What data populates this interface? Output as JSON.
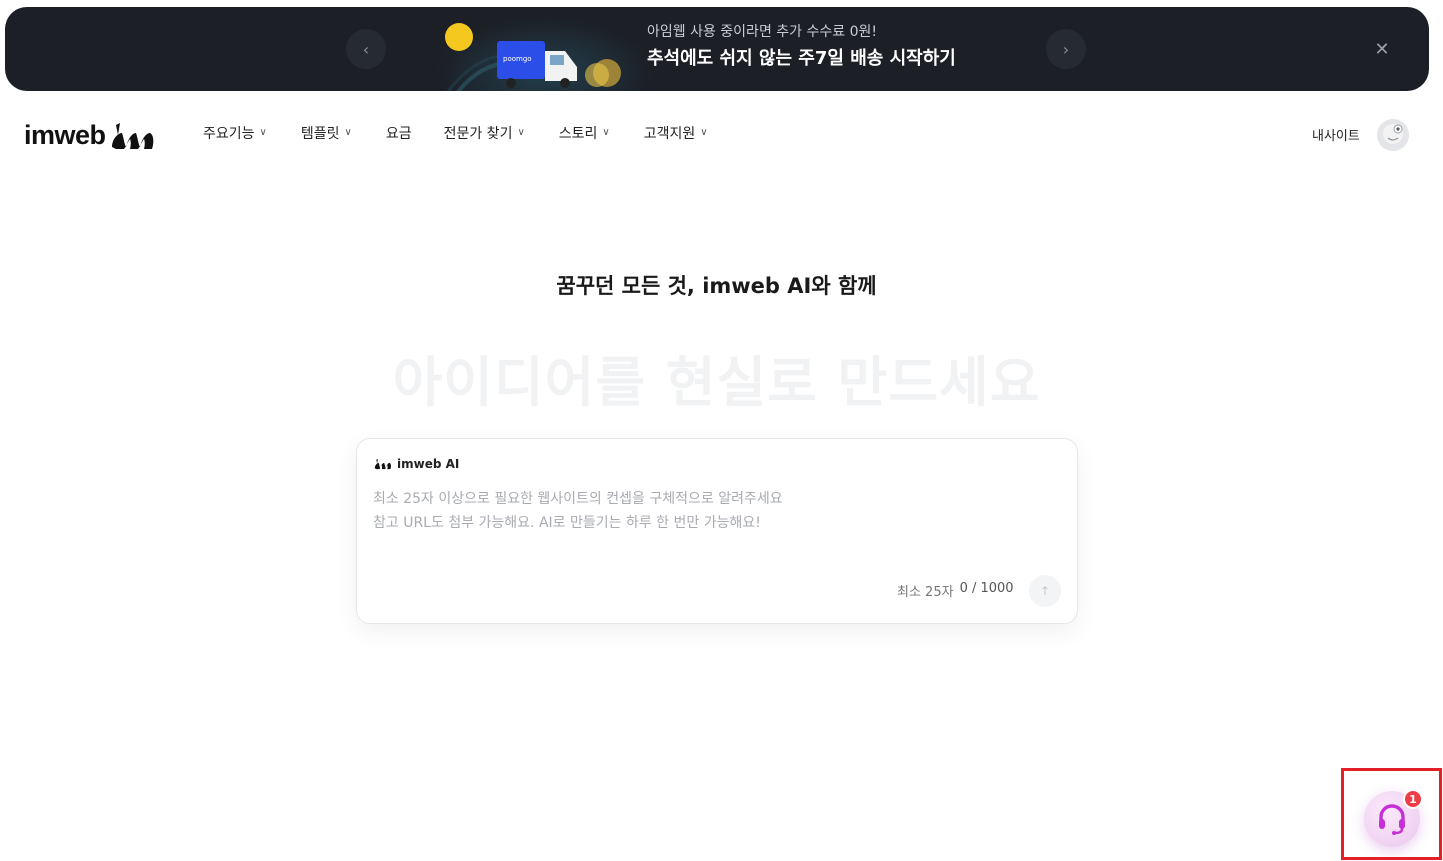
{
  "banner": {
    "subtitle": "아임웹 사용 중이라면 추가 수수료 0원!",
    "title": "추석에도 쉬지 않는 주7일 배송 시작하기",
    "truck_label": "poomgo",
    "prev_icon": "chevron-left-icon",
    "next_icon": "chevron-right-icon",
    "close_icon": "close-icon"
  },
  "header": {
    "logo_text": "imweb",
    "menu": [
      {
        "label": "주요기능",
        "has_dropdown": true
      },
      {
        "label": "템플릿",
        "has_dropdown": true
      },
      {
        "label": "요금",
        "has_dropdown": false
      },
      {
        "label": "전문가 찾기",
        "has_dropdown": true
      },
      {
        "label": "스토리",
        "has_dropdown": true
      },
      {
        "label": "고객지원",
        "has_dropdown": true
      }
    ],
    "my_site_label": "내사이트"
  },
  "hero": {
    "title": "꿈꾸던 모든 것, imweb AI와 함께",
    "big_text": "아이디어를 현실로 만드세요"
  },
  "prompt_card": {
    "label": "imweb AI",
    "placeholder": "최소 25자 이상으로 필요한 웹사이트의 컨셉을 구체적으로 알려주세요\n참고 URL도 첨부 가능해요. AI로 만들기는 하루 한 번만 가능해요!",
    "value": "",
    "min_note": "최소 25자",
    "count": "0 / 1000",
    "send_icon": "arrow-up-icon"
  },
  "support": {
    "icon": "headset-icon",
    "badge_count": "1"
  },
  "colors": {
    "banner_bg": "#1c1f26",
    "highlight": "#e3202a",
    "support_icon": "#c62fd6",
    "badge": "#ef3d47"
  }
}
